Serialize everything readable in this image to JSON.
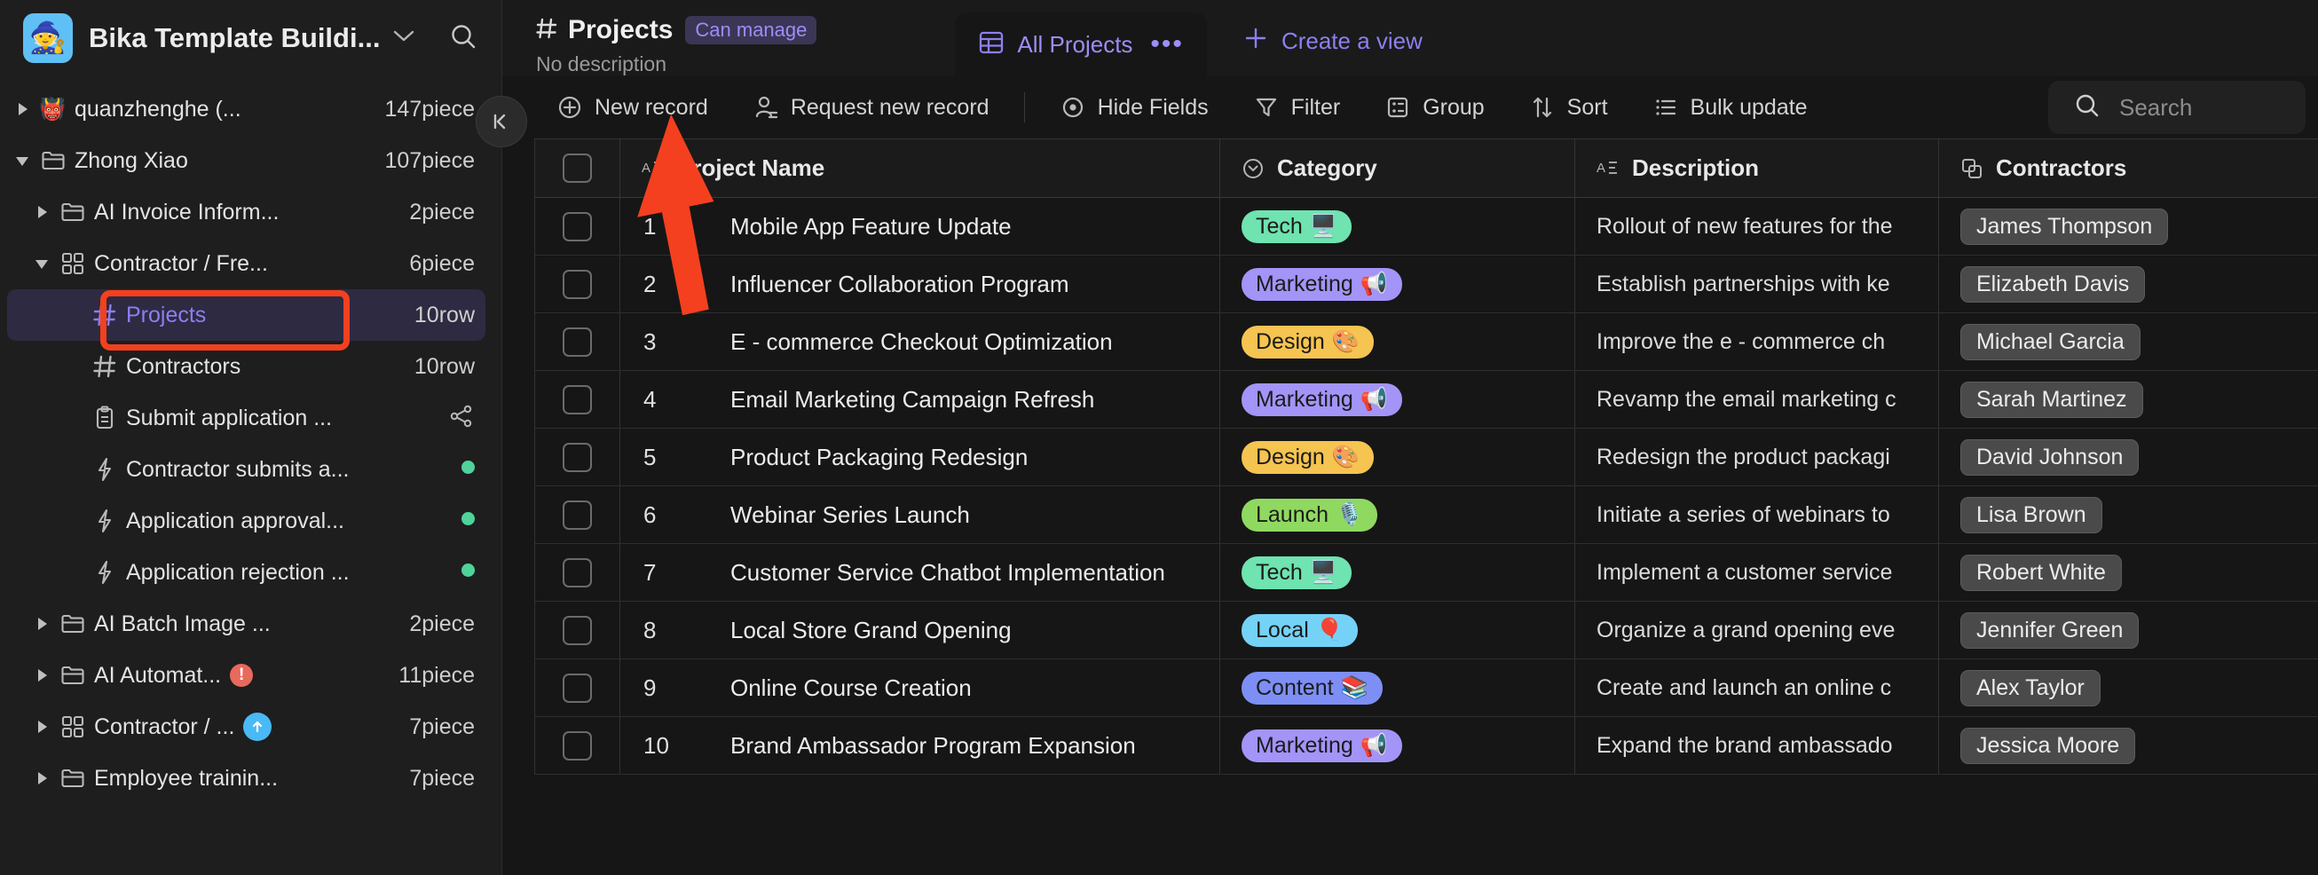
{
  "workspace": {
    "logo_emoji": "🧙",
    "name": "Bika Template Buildi...",
    "caret_icon": "chevron-down-icon",
    "search_icon": "search-icon"
  },
  "sidebar": {
    "items": [
      {
        "label": "quanzhenghe (...",
        "count": "147piece",
        "depth": 0,
        "twisty": "collapsed",
        "icon": "emoji",
        "emoji": "👹",
        "selected": false
      },
      {
        "label": "Zhong Xiao",
        "count": "107piece",
        "depth": 0,
        "twisty": "expanded",
        "icon": "folder-icon",
        "selected": false
      },
      {
        "label": "AI Invoice Inform...",
        "count": "2piece",
        "depth": 1,
        "twisty": "collapsed",
        "icon": "folder-icon",
        "selected": false
      },
      {
        "label": "Contractor / Fre...",
        "count": "6piece",
        "depth": 1,
        "twisty": "expanded",
        "icon": "grid-icon",
        "selected": false
      },
      {
        "label": "Projects",
        "count": "10row",
        "depth": 2,
        "twisty": "none",
        "icon": "hash-icon",
        "selected": true
      },
      {
        "label": "Contractors",
        "count": "10row",
        "depth": 2,
        "twisty": "none",
        "icon": "hash-icon",
        "selected": false
      },
      {
        "label": "Submit application ...",
        "count": "",
        "depth": 2,
        "twisty": "none",
        "icon": "clipboard-icon",
        "trailing": "share-icon",
        "selected": false
      },
      {
        "label": "Contractor submits a...",
        "count": "",
        "depth": 2,
        "twisty": "none",
        "icon": "bolt-icon",
        "trailing": "green-dot",
        "selected": false
      },
      {
        "label": "Application approval...",
        "count": "",
        "depth": 2,
        "twisty": "none",
        "icon": "bolt-icon",
        "trailing": "green-dot",
        "selected": false
      },
      {
        "label": "Application rejection ...",
        "count": "",
        "depth": 2,
        "twisty": "none",
        "icon": "bolt-icon",
        "trailing": "green-dot",
        "selected": false
      },
      {
        "label": "AI Batch Image ...",
        "count": "2piece",
        "depth": 1,
        "twisty": "collapsed",
        "icon": "folder-icon",
        "selected": false
      },
      {
        "label": "AI Automat...",
        "count": "11piece",
        "depth": 1,
        "twisty": "collapsed",
        "icon": "folder-icon",
        "marker": "alert-icon",
        "selected": false
      },
      {
        "label": "Contractor / ...",
        "count": "7piece",
        "depth": 1,
        "twisty": "collapsed",
        "icon": "grid-icon",
        "marker": "upload-icon",
        "selected": false
      },
      {
        "label": "Employee trainin...",
        "count": "7piece",
        "depth": 1,
        "twisty": "collapsed",
        "icon": "folder-icon",
        "selected": false
      }
    ],
    "collapse_icon": "collapse-sidebar-icon"
  },
  "header": {
    "hash_icon": "hash-icon",
    "title": "Projects",
    "permission_badge": "Can manage",
    "description": "No description",
    "tab": {
      "icon": "table-icon",
      "label": "All Projects",
      "more": "•••"
    },
    "create_view": {
      "icon": "plus-icon",
      "label": "Create a view"
    }
  },
  "toolbar": {
    "items": [
      {
        "icon": "plus-circle-icon",
        "label": "New record"
      },
      {
        "icon": "person-add-icon",
        "label": "Request new record"
      },
      {
        "icon": "eye-icon",
        "label": "Hide Fields"
      },
      {
        "icon": "funnel-icon",
        "label": "Filter"
      },
      {
        "icon": "group-icon",
        "label": "Group"
      },
      {
        "icon": "sort-icon",
        "label": "Sort"
      },
      {
        "icon": "list-icon",
        "label": "Bulk update"
      }
    ],
    "search": {
      "icon": "search-icon",
      "placeholder": "Search",
      "value": ""
    }
  },
  "grid": {
    "columns": [
      {
        "label": "Project Name",
        "icon": "text-field-icon"
      },
      {
        "label": "Category",
        "icon": "select-field-icon"
      },
      {
        "label": "Description",
        "icon": "text-field-icon"
      },
      {
        "label": "Contractors",
        "icon": "link-field-icon"
      }
    ],
    "rows": [
      {
        "index": "1",
        "name": "Mobile App Feature Update",
        "category": "Tech",
        "cat_emoji": "🖥️",
        "cat_color": "#6fe3b0",
        "description": "Rollout of new features for the",
        "contractor": "James Thompson"
      },
      {
        "index": "2",
        "name": "Influencer Collaboration Program",
        "category": "Marketing",
        "cat_emoji": "📢",
        "cat_color": "#a394f7",
        "description": "Establish partnerships with ke",
        "contractor": "Elizabeth Davis"
      },
      {
        "index": "3",
        "name": "E - commerce Checkout Optimization",
        "category": "Design",
        "cat_emoji": "🎨",
        "cat_color": "#f5c451",
        "description": "Improve the e - commerce ch",
        "contractor": "Michael Garcia"
      },
      {
        "index": "4",
        "name": "Email Marketing Campaign Refresh",
        "category": "Marketing",
        "cat_emoji": "📢",
        "cat_color": "#a394f7",
        "description": "Revamp the email marketing c",
        "contractor": "Sarah Martinez"
      },
      {
        "index": "5",
        "name": "Product Packaging Redesign",
        "category": "Design",
        "cat_emoji": "🎨",
        "cat_color": "#f5c451",
        "description": "Redesign the product packagi",
        "contractor": "David Johnson"
      },
      {
        "index": "6",
        "name": "Webinar Series Launch",
        "category": "Launch",
        "cat_emoji": "🎙️",
        "cat_color": "#8fd960",
        "description": "Initiate a series of webinars to",
        "contractor": "Lisa Brown"
      },
      {
        "index": "7",
        "name": "Customer Service Chatbot Implementation",
        "category": "Tech",
        "cat_emoji": "🖥️",
        "cat_color": "#6fe3b0",
        "description": "Implement a customer service",
        "contractor": "Robert White"
      },
      {
        "index": "8",
        "name": "Local Store Grand Opening",
        "category": "Local",
        "cat_emoji": "🎈",
        "cat_color": "#74d2f7",
        "description": "Organize a grand opening eve",
        "contractor": "Jennifer Green"
      },
      {
        "index": "9",
        "name": "Online Course Creation",
        "category": "Content",
        "cat_emoji": "📚",
        "cat_color": "#7d8ff5",
        "description": "Create and launch an online c",
        "contractor": "Alex Taylor"
      },
      {
        "index": "10",
        "name": "Brand Ambassador Program Expansion",
        "category": "Marketing",
        "cat_emoji": "📢",
        "cat_color": "#a394f7",
        "description": "Expand the brand ambassado",
        "contractor": "Jessica Moore"
      }
    ]
  },
  "annotations": {
    "highlight_color": "#f4401f",
    "arrow_target": "New record"
  }
}
